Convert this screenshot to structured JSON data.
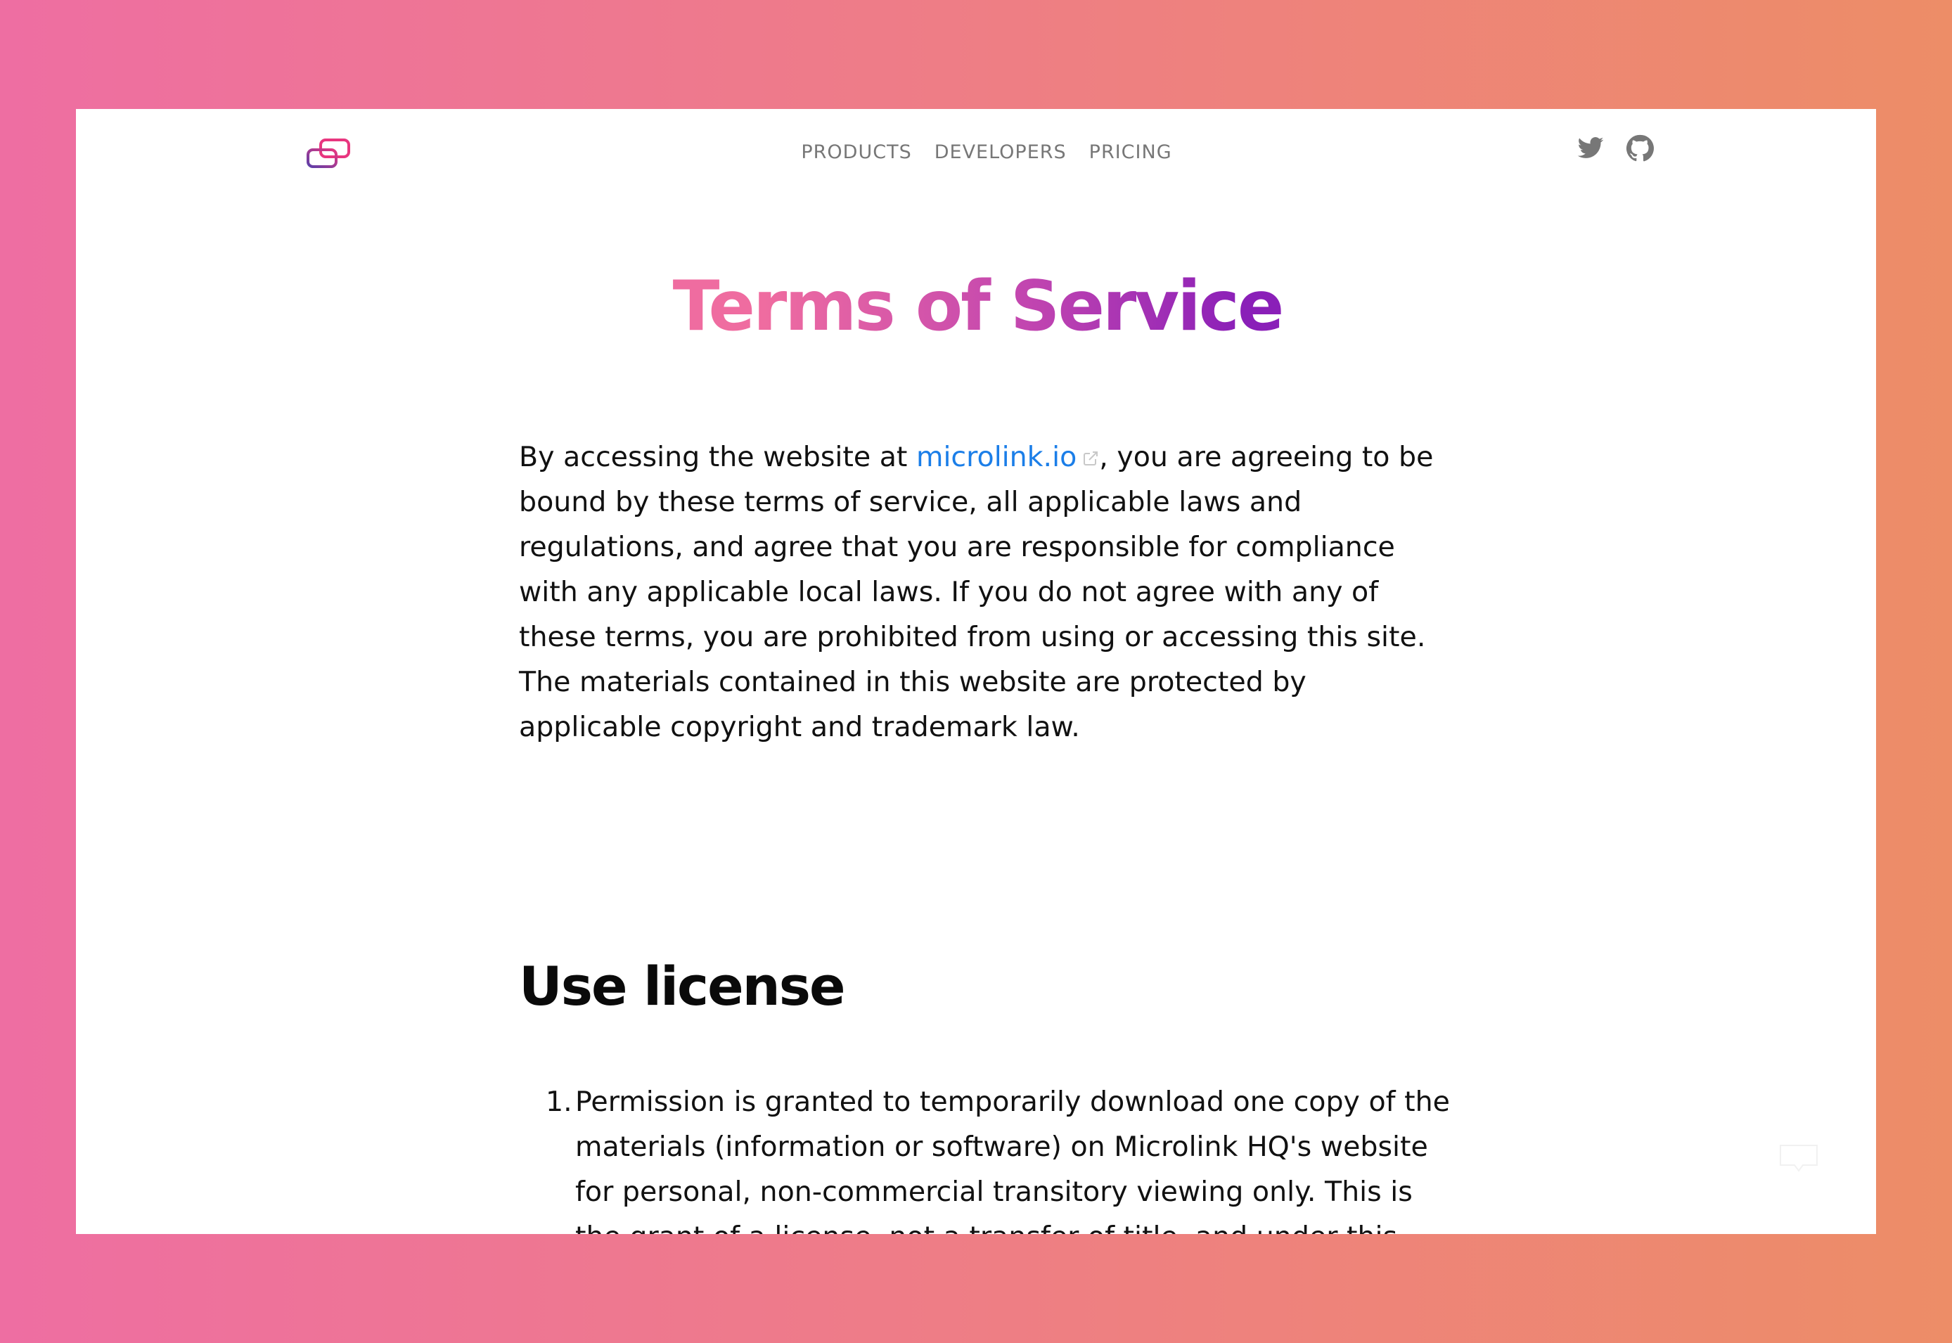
{
  "nav": {
    "items": [
      {
        "label": "PRODUCTS"
      },
      {
        "label": "DEVELOPERS"
      },
      {
        "label": "PRICING"
      }
    ]
  },
  "social": {
    "twitter_icon": "twitter-icon",
    "github_icon": "github-icon"
  },
  "page": {
    "title": "Terms of Service",
    "intro_before": "By accessing the website at ",
    "intro_link": "microlink.io",
    "intro_after": ", you are agreeing to be bound by these terms of service, all applicable laws and regulations, and agree that you are responsible for compliance with any applicable local laws. If you do not agree with any of these terms, you are prohibited from using or accessing this site. The materials contained in this website are protected by applicable copyright and trademark law."
  },
  "use_license": {
    "heading": "Use license",
    "items": [
      {
        "number": "1.",
        "text": "Permission is granted to temporarily download one copy of the materials (information or software) on Microlink HQ's website for personal, non-commercial transitory viewing only. This is the grant of a license, not a transfer of title, and under this license you may not:"
      }
    ]
  },
  "colors": {
    "background_left": "#ee6ea2",
    "background_right": "#ed8d67",
    "link": "#1b7ee8",
    "title_gradient_start": "#ef6ca0",
    "title_gradient_end": "#8a1fb8",
    "nav_text": "#777777"
  }
}
